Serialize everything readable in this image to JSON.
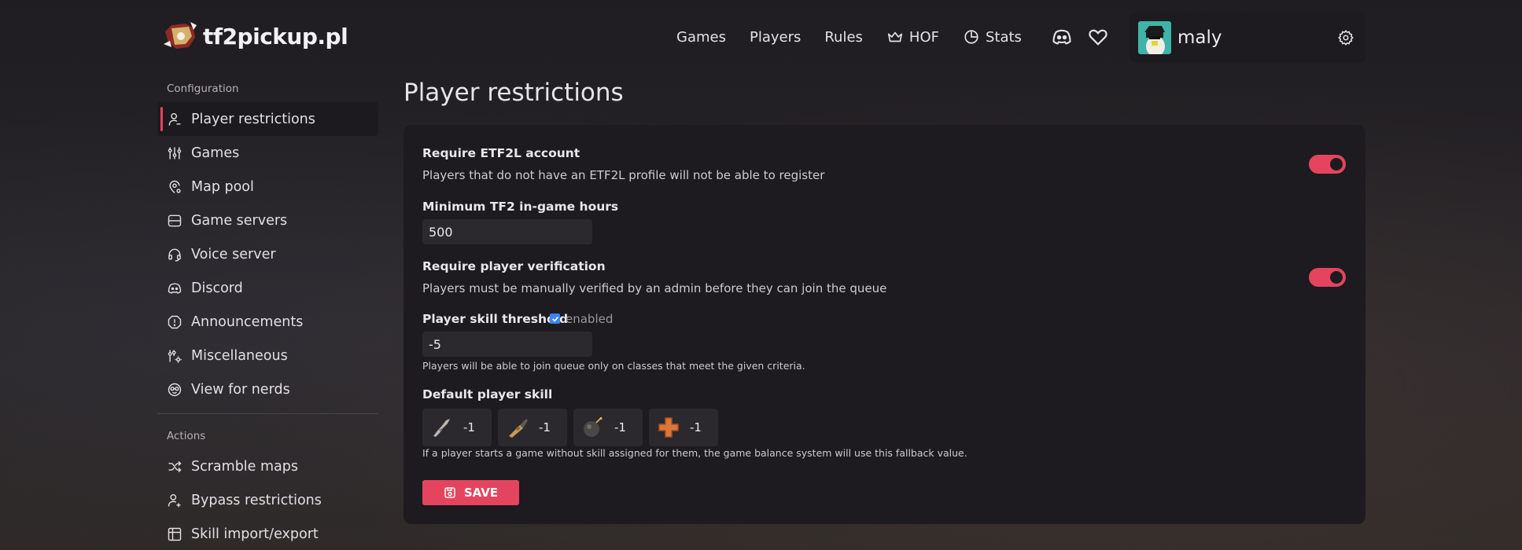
{
  "header": {
    "logo_text": "tf2pickup.pl",
    "nav": [
      {
        "label": "Games",
        "icon": "none"
      },
      {
        "label": "Players",
        "icon": "none"
      },
      {
        "label": "Rules",
        "icon": "none"
      },
      {
        "label": "HOF",
        "icon": "crown-icon"
      },
      {
        "label": "Stats",
        "icon": "pie-chart-icon"
      }
    ],
    "icons": [
      "discord-icon",
      "heart-icon"
    ],
    "user": {
      "name": "maly",
      "settings_icon": "gear-icon"
    }
  },
  "sidebar": {
    "configuration_title": "Configuration",
    "config_items": [
      {
        "label": "Player restrictions",
        "icon": "user-icon",
        "active": true
      },
      {
        "label": "Games",
        "icon": "sliders-icon"
      },
      {
        "label": "Map pool",
        "icon": "map-pin-icon"
      },
      {
        "label": "Game servers",
        "icon": "server-icon"
      },
      {
        "label": "Voice server",
        "icon": "headset-icon"
      },
      {
        "label": "Discord",
        "icon": "discord-icon"
      },
      {
        "label": "Announcements",
        "icon": "alert-icon"
      },
      {
        "label": "Miscellaneous",
        "icon": "adjustments-icon"
      },
      {
        "label": "View for nerds",
        "icon": "nerd-icon"
      }
    ],
    "actions_title": "Actions",
    "action_items": [
      {
        "label": "Scramble maps",
        "icon": "shuffle-icon"
      },
      {
        "label": "Bypass restrictions",
        "icon": "user-plus-icon"
      },
      {
        "label": "Skill import/export",
        "icon": "table-icon"
      }
    ]
  },
  "main": {
    "title": "Player restrictions",
    "etf2l": {
      "label": "Require ETF2L account",
      "description": "Players that do not have an ETF2L profile will not be able to register",
      "enabled": true
    },
    "min_hours": {
      "label": "Minimum TF2 in-game hours",
      "value": "500"
    },
    "verification": {
      "label": "Require player verification",
      "description": "Players must be manually verified by an admin before they can join the queue",
      "enabled": true
    },
    "skill_threshold": {
      "label": "Player skill threshold",
      "checkbox_label": "enabled",
      "checked": true,
      "value": "-5",
      "hint": "Players will be able to join queue only on classes that meet the given criteria."
    },
    "default_skill": {
      "label": "Default player skill",
      "classes": [
        {
          "class_icon": "scout-icon",
          "value": "-1"
        },
        {
          "class_icon": "soldier-icon",
          "value": "-1"
        },
        {
          "class_icon": "demoman-icon",
          "value": "-1"
        },
        {
          "class_icon": "medic-icon",
          "value": "-1"
        }
      ],
      "hint": "If a player starts a game without skill assigned for them, the game balance system will use this fallback value."
    },
    "save_label": "SAVE",
    "colors": {
      "accent": "#e5445e",
      "card": "#1d1b1f",
      "input": "#2b292e"
    }
  }
}
